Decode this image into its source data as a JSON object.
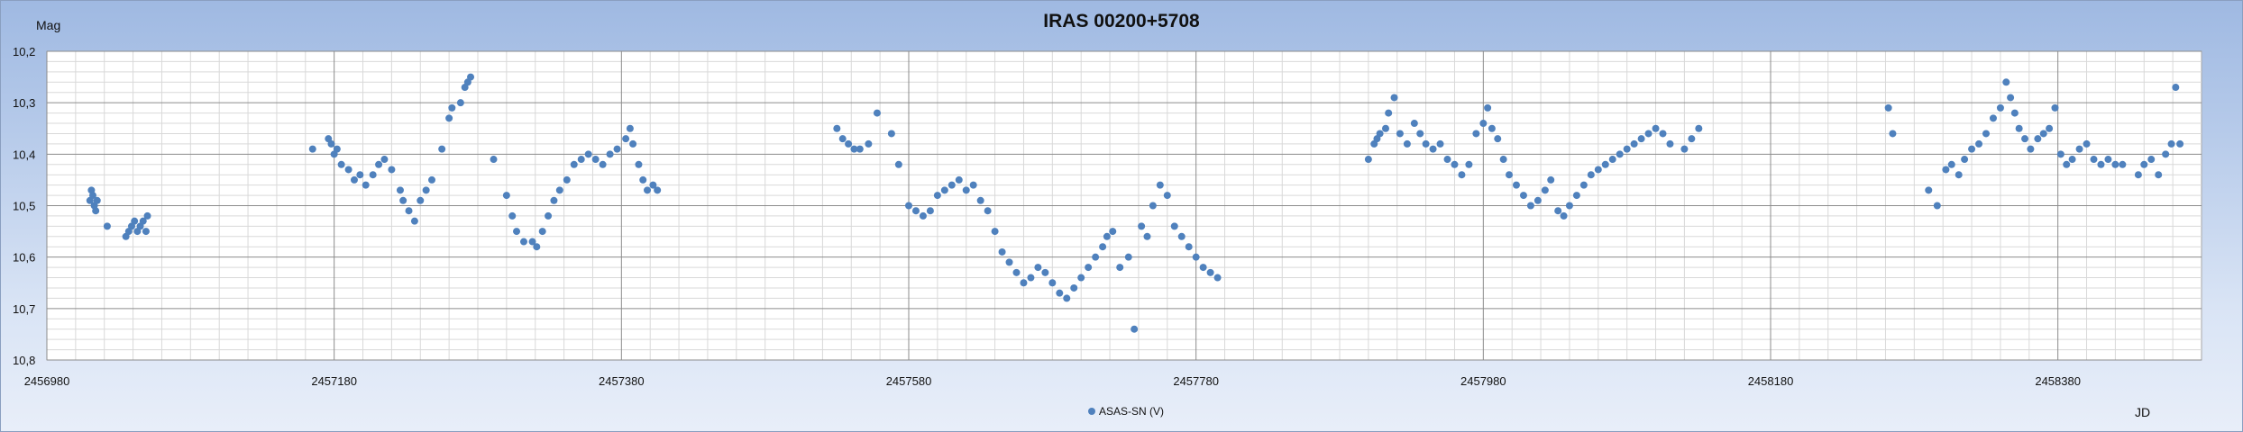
{
  "chart_data": {
    "type": "scatter",
    "title": "IRAS 00200+5708",
    "ylabel": "Mag",
    "xlabel": "JD",
    "xlim": [
      2456980,
      2458480
    ],
    "ylim": [
      10.2,
      10.8
    ],
    "y_reversed": true,
    "x_ticks": [
      2456980,
      2457180,
      2457380,
      2457580,
      2457780,
      2457980,
      2458180,
      2458380
    ],
    "x_tick_labels": [
      "2456980",
      "2457180",
      "2457380",
      "2457580",
      "2457780",
      "2457980",
      "2458180",
      "2458380"
    ],
    "y_ticks": [
      10.2,
      10.3,
      10.4,
      10.5,
      10.6,
      10.7,
      10.8
    ],
    "y_tick_labels": [
      "10,2",
      "10,3",
      "10,4",
      "10,5",
      "10,6",
      "10,7",
      "10,8"
    ],
    "grid": true,
    "legend_position": "bottom",
    "marker_color": "#4f81bd",
    "series": [
      {
        "name": "ASAS-SN (V)",
        "points": [
          [
            2457010,
            10.49
          ],
          [
            2457011,
            10.47
          ],
          [
            2457012,
            10.48
          ],
          [
            2457013,
            10.5
          ],
          [
            2457014,
            10.51
          ],
          [
            2457015,
            10.49
          ],
          [
            2457022,
            10.54
          ],
          [
            2457035,
            10.56
          ],
          [
            2457037,
            10.55
          ],
          [
            2457039,
            10.54
          ],
          [
            2457041,
            10.53
          ],
          [
            2457043,
            10.55
          ],
          [
            2457045,
            10.54
          ],
          [
            2457047,
            10.53
          ],
          [
            2457049,
            10.55
          ],
          [
            2457050,
            10.52
          ],
          [
            2457165,
            10.39
          ],
          [
            2457176,
            10.37
          ],
          [
            2457178,
            10.38
          ],
          [
            2457180,
            10.4
          ],
          [
            2457182,
            10.39
          ],
          [
            2457185,
            10.42
          ],
          [
            2457190,
            10.43
          ],
          [
            2457194,
            10.45
          ],
          [
            2457198,
            10.44
          ],
          [
            2457202,
            10.46
          ],
          [
            2457207,
            10.44
          ],
          [
            2457211,
            10.42
          ],
          [
            2457215,
            10.41
          ],
          [
            2457220,
            10.43
          ],
          [
            2457226,
            10.47
          ],
          [
            2457228,
            10.49
          ],
          [
            2457232,
            10.51
          ],
          [
            2457236,
            10.53
          ],
          [
            2457240,
            10.49
          ],
          [
            2457244,
            10.47
          ],
          [
            2457248,
            10.45
          ],
          [
            2457255,
            10.39
          ],
          [
            2457260,
            10.33
          ],
          [
            2457262,
            10.31
          ],
          [
            2457268,
            10.3
          ],
          [
            2457271,
            10.27
          ],
          [
            2457273,
            10.26
          ],
          [
            2457275,
            10.25
          ],
          [
            2457291,
            10.41
          ],
          [
            2457300,
            10.48
          ],
          [
            2457304,
            10.52
          ],
          [
            2457307,
            10.55
          ],
          [
            2457312,
            10.57
          ],
          [
            2457318,
            10.57
          ],
          [
            2457321,
            10.58
          ],
          [
            2457325,
            10.55
          ],
          [
            2457329,
            10.52
          ],
          [
            2457333,
            10.49
          ],
          [
            2457337,
            10.47
          ],
          [
            2457342,
            10.45
          ],
          [
            2457347,
            10.42
          ],
          [
            2457352,
            10.41
          ],
          [
            2457357,
            10.4
          ],
          [
            2457362,
            10.41
          ],
          [
            2457367,
            10.42
          ],
          [
            2457372,
            10.4
          ],
          [
            2457377,
            10.39
          ],
          [
            2457383,
            10.37
          ],
          [
            2457386,
            10.35
          ],
          [
            2457388,
            10.38
          ],
          [
            2457392,
            10.42
          ],
          [
            2457395,
            10.45
          ],
          [
            2457398,
            10.47
          ],
          [
            2457402,
            10.46
          ],
          [
            2457405,
            10.47
          ],
          [
            2457530,
            10.35
          ],
          [
            2457534,
            10.37
          ],
          [
            2457538,
            10.38
          ],
          [
            2457542,
            10.39
          ],
          [
            2457546,
            10.39
          ],
          [
            2457552,
            10.38
          ],
          [
            2457558,
            10.32
          ],
          [
            2457568,
            10.36
          ],
          [
            2457573,
            10.42
          ],
          [
            2457580,
            10.5
          ],
          [
            2457585,
            10.51
          ],
          [
            2457590,
            10.52
          ],
          [
            2457595,
            10.51
          ],
          [
            2457600,
            10.48
          ],
          [
            2457605,
            10.47
          ],
          [
            2457610,
            10.46
          ],
          [
            2457615,
            10.45
          ],
          [
            2457620,
            10.47
          ],
          [
            2457625,
            10.46
          ],
          [
            2457630,
            10.49
          ],
          [
            2457635,
            10.51
          ],
          [
            2457640,
            10.55
          ],
          [
            2457645,
            10.59
          ],
          [
            2457650,
            10.61
          ],
          [
            2457655,
            10.63
          ],
          [
            2457660,
            10.65
          ],
          [
            2457665,
            10.64
          ],
          [
            2457670,
            10.62
          ],
          [
            2457675,
            10.63
          ],
          [
            2457680,
            10.65
          ],
          [
            2457685,
            10.67
          ],
          [
            2457690,
            10.68
          ],
          [
            2457695,
            10.66
          ],
          [
            2457700,
            10.64
          ],
          [
            2457705,
            10.62
          ],
          [
            2457710,
            10.6
          ],
          [
            2457715,
            10.58
          ],
          [
            2457718,
            10.56
          ],
          [
            2457722,
            10.55
          ],
          [
            2457727,
            10.62
          ],
          [
            2457733,
            10.6
          ],
          [
            2457737,
            10.74
          ],
          [
            2457742,
            10.54
          ],
          [
            2457746,
            10.56
          ],
          [
            2457750,
            10.5
          ],
          [
            2457755,
            10.46
          ],
          [
            2457760,
            10.48
          ],
          [
            2457765,
            10.54
          ],
          [
            2457770,
            10.56
          ],
          [
            2457775,
            10.58
          ],
          [
            2457780,
            10.6
          ],
          [
            2457785,
            10.62
          ],
          [
            2457790,
            10.63
          ],
          [
            2457795,
            10.64
          ],
          [
            2457900,
            10.41
          ],
          [
            2457904,
            10.38
          ],
          [
            2457906,
            10.37
          ],
          [
            2457908,
            10.36
          ],
          [
            2457912,
            10.35
          ],
          [
            2457914,
            10.32
          ],
          [
            2457918,
            10.29
          ],
          [
            2457922,
            10.36
          ],
          [
            2457927,
            10.38
          ],
          [
            2457932,
            10.34
          ],
          [
            2457936,
            10.36
          ],
          [
            2457940,
            10.38
          ],
          [
            2457945,
            10.39
          ],
          [
            2457950,
            10.38
          ],
          [
            2457955,
            10.41
          ],
          [
            2457960,
            10.42
          ],
          [
            2457965,
            10.44
          ],
          [
            2457970,
            10.42
          ],
          [
            2457975,
            10.36
          ],
          [
            2457980,
            10.34
          ],
          [
            2457983,
            10.31
          ],
          [
            2457986,
            10.35
          ],
          [
            2457990,
            10.37
          ],
          [
            2457994,
            10.41
          ],
          [
            2457998,
            10.44
          ],
          [
            2458003,
            10.46
          ],
          [
            2458008,
            10.48
          ],
          [
            2458013,
            10.5
          ],
          [
            2458018,
            10.49
          ],
          [
            2458023,
            10.47
          ],
          [
            2458027,
            10.45
          ],
          [
            2458032,
            10.51
          ],
          [
            2458036,
            10.52
          ],
          [
            2458040,
            10.5
          ],
          [
            2458045,
            10.48
          ],
          [
            2458050,
            10.46
          ],
          [
            2458055,
            10.44
          ],
          [
            2458060,
            10.43
          ],
          [
            2458065,
            10.42
          ],
          [
            2458070,
            10.41
          ],
          [
            2458075,
            10.4
          ],
          [
            2458080,
            10.39
          ],
          [
            2458085,
            10.38
          ],
          [
            2458090,
            10.37
          ],
          [
            2458095,
            10.36
          ],
          [
            2458100,
            10.35
          ],
          [
            2458105,
            10.36
          ],
          [
            2458110,
            10.38
          ],
          [
            2458120,
            10.39
          ],
          [
            2458125,
            10.37
          ],
          [
            2458130,
            10.35
          ],
          [
            2458262,
            10.31
          ],
          [
            2458265,
            10.36
          ],
          [
            2458290,
            10.47
          ],
          [
            2458296,
            10.5
          ],
          [
            2458302,
            10.43
          ],
          [
            2458306,
            10.42
          ],
          [
            2458311,
            10.44
          ],
          [
            2458315,
            10.41
          ],
          [
            2458320,
            10.39
          ],
          [
            2458325,
            10.38
          ],
          [
            2458330,
            10.36
          ],
          [
            2458335,
            10.33
          ],
          [
            2458340,
            10.31
          ],
          [
            2458344,
            10.26
          ],
          [
            2458347,
            10.29
          ],
          [
            2458350,
            10.32
          ],
          [
            2458353,
            10.35
          ],
          [
            2458357,
            10.37
          ],
          [
            2458361,
            10.39
          ],
          [
            2458366,
            10.37
          ],
          [
            2458370,
            10.36
          ],
          [
            2458374,
            10.35
          ],
          [
            2458378,
            10.31
          ],
          [
            2458382,
            10.4
          ],
          [
            2458386,
            10.42
          ],
          [
            2458390,
            10.41
          ],
          [
            2458395,
            10.39
          ],
          [
            2458400,
            10.38
          ],
          [
            2458405,
            10.41
          ],
          [
            2458410,
            10.42
          ],
          [
            2458415,
            10.41
          ],
          [
            2458420,
            10.42
          ],
          [
            2458425,
            10.42
          ],
          [
            2458436,
            10.44
          ],
          [
            2458440,
            10.42
          ],
          [
            2458445,
            10.41
          ],
          [
            2458450,
            10.44
          ],
          [
            2458455,
            10.4
          ],
          [
            2458459,
            10.38
          ],
          [
            2458462,
            10.27
          ],
          [
            2458465,
            10.38
          ]
        ]
      }
    ]
  }
}
